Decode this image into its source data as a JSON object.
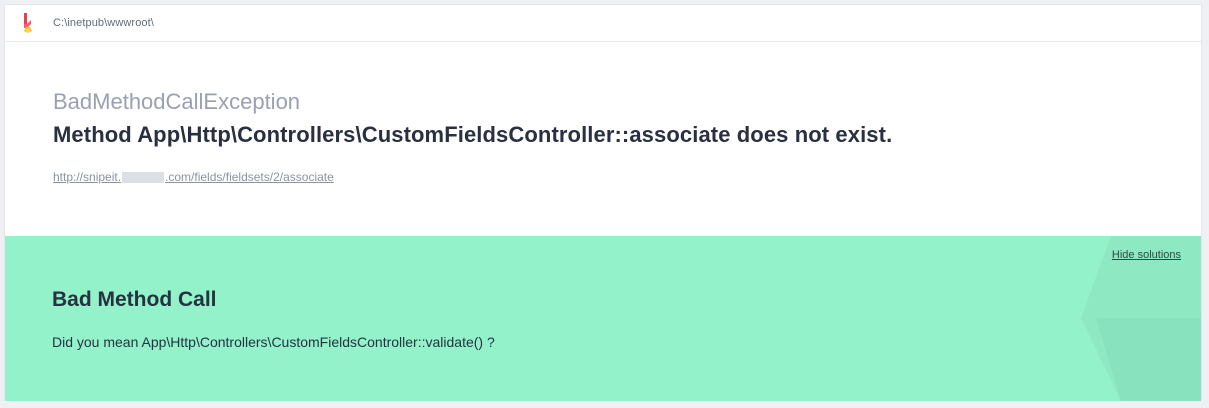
{
  "header": {
    "path": "C:\\inetpub\\wwwroot\\",
    "logo_icon": "ignition-logo-icon"
  },
  "error": {
    "exception_class": "BadMethodCallException",
    "message": "Method App\\Http\\Controllers\\CustomFieldsController::associate does not exist.",
    "url_prefix": "http://snipeit.",
    "url_suffix": ".com/fields/fieldsets/2/associate"
  },
  "solution": {
    "hide_label": "Hide solutions",
    "title": "Bad Method Call",
    "text": "Did you mean App\\Http\\Controllers\\CustomFieldsController::validate() ?"
  },
  "colors": {
    "solution_bg": "#94f2cb",
    "title": "#283041",
    "muted": "#9aa0b1"
  }
}
